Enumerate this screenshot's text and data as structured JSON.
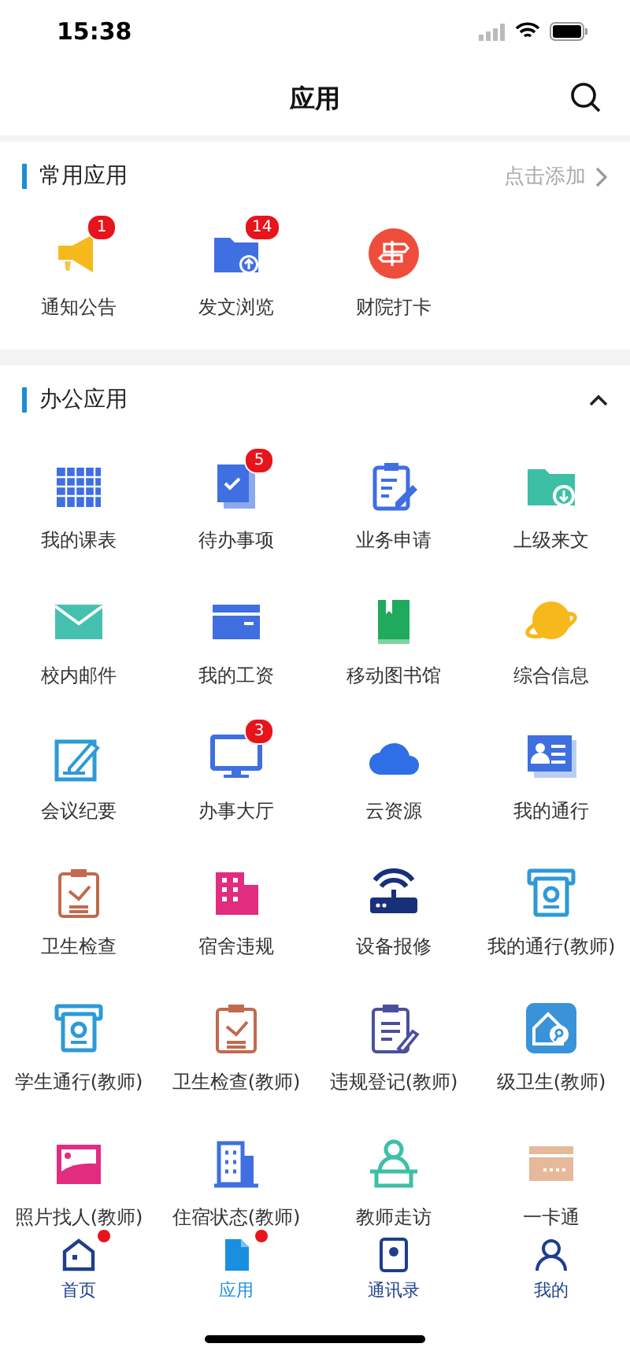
{
  "status_bar": {
    "time": "15:38"
  },
  "header": {
    "title": "应用"
  },
  "sections": [
    {
      "title": "常用应用",
      "action": "点击添加",
      "tiles": [
        {
          "label": "通知公告",
          "badge": "1"
        },
        {
          "label": "发文浏览",
          "badge": "14"
        },
        {
          "label": "财院打卡"
        }
      ]
    },
    {
      "title": "办公应用",
      "expanded": true,
      "tiles": [
        {
          "label": "我的课表"
        },
        {
          "label": "待办事项",
          "badge": "5"
        },
        {
          "label": "业务申请"
        },
        {
          "label": "上级来文"
        },
        {
          "label": "校内邮件"
        },
        {
          "label": "我的工资"
        },
        {
          "label": "移动图书馆"
        },
        {
          "label": "综合信息"
        },
        {
          "label": "会议纪要"
        },
        {
          "label": "办事大厅",
          "badge": "3"
        },
        {
          "label": "云资源"
        },
        {
          "label": "我的通行"
        },
        {
          "label": "卫生检查"
        },
        {
          "label": "宿舍违规"
        },
        {
          "label": "设备报修"
        },
        {
          "label": "我的通行(教师)"
        },
        {
          "label": "学生通行(教师)"
        },
        {
          "label": "卫生检查(教师)"
        },
        {
          "label": "违规登记(教师)"
        },
        {
          "label": "级卫生(教师)"
        },
        {
          "label": "照片找人(教师)"
        },
        {
          "label": "住宿状态(教师)"
        },
        {
          "label": "教师走访"
        },
        {
          "label": "一卡通"
        }
      ]
    }
  ],
  "tab_bar": [
    {
      "label": "首页",
      "selected": false,
      "dot": true
    },
    {
      "label": "应用",
      "selected": true,
      "dot": true
    },
    {
      "label": "通讯录",
      "selected": false,
      "dot": false
    },
    {
      "label": "我的",
      "selected": false,
      "dot": false
    }
  ]
}
